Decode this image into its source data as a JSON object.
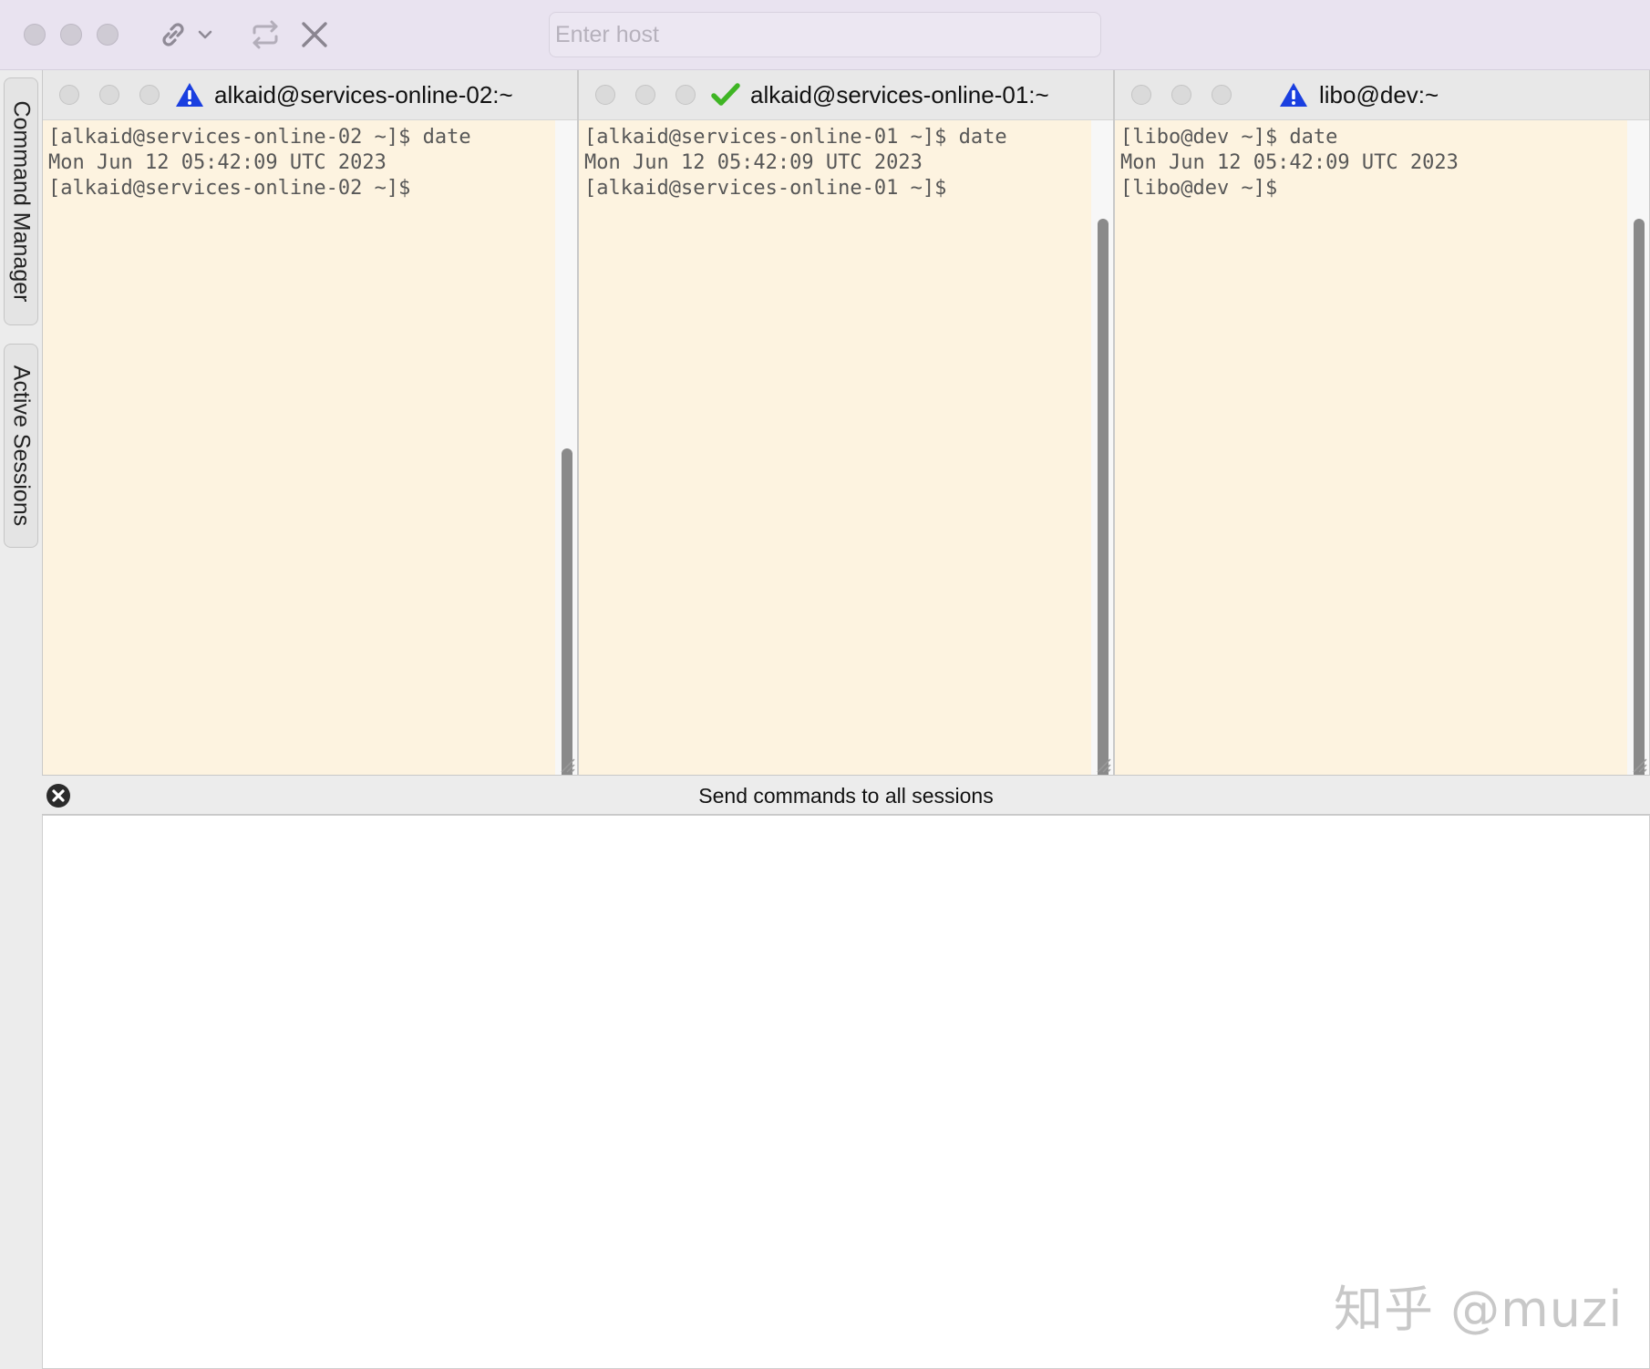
{
  "toolbar": {
    "host_placeholder": "Enter host",
    "host_value": "",
    "icons": [
      "link-icon",
      "chevron-down-icon",
      "repeat-icon",
      "close-icon"
    ]
  },
  "side_tabs": [
    {
      "label": "Command Manager"
    },
    {
      "label": "Active Sessions"
    }
  ],
  "sessions": [
    {
      "title": "alkaid@services-online-02:~",
      "status": "warning",
      "lines": [
        "[alkaid@services-online-02 ~]$ date",
        "Mon Jun 12 05:42:09 UTC 2023",
        "[alkaid@services-online-02 ~]$"
      ]
    },
    {
      "title": "alkaid@services-online-01:~",
      "status": "ok",
      "lines": [
        "[alkaid@services-online-01 ~]$ date",
        "Mon Jun 12 05:42:09 UTC 2023",
        "[alkaid@services-online-01 ~]$"
      ]
    },
    {
      "title": "libo@dev:~",
      "status": "warning",
      "lines": [
        "[libo@dev ~]$ date",
        "Mon Jun 12 05:42:09 UTC 2023",
        "[libo@dev ~]$"
      ]
    }
  ],
  "broadcast": {
    "title": "Send commands to all sessions",
    "value": ""
  },
  "watermark": "知乎 @muzi",
  "colors": {
    "toolbar_bg": "#e9e3f0",
    "terminal_bg": "#fdf3e0",
    "warning_blue": "#1a3fe0",
    "ok_green": "#3fb524"
  }
}
